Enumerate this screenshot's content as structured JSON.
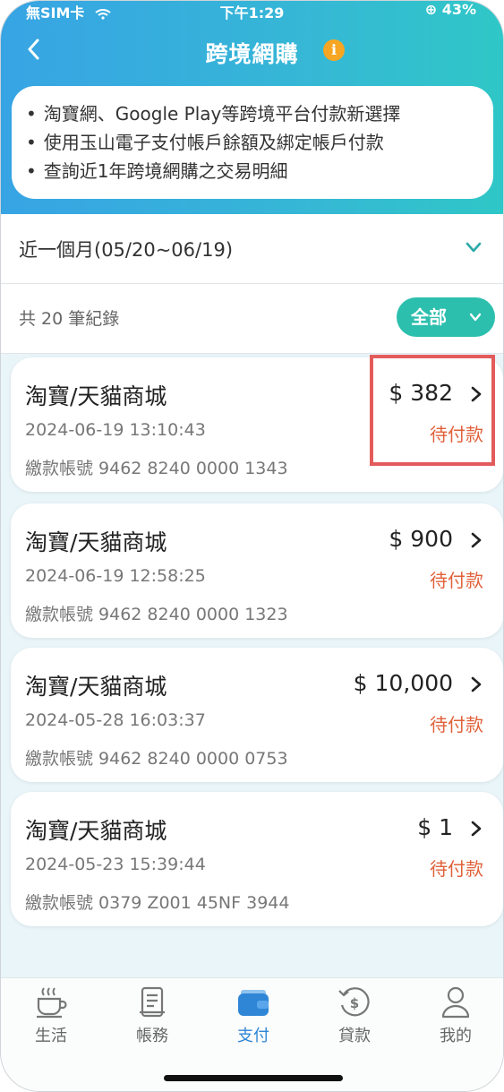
{
  "status_bar": {
    "carrier": "無SIM卡",
    "time": "下午1:29",
    "battery": "⊕ 43%"
  },
  "header": {
    "title": "跨境網購",
    "info_icon": "i"
  },
  "info": {
    "lines": [
      "淘寶網、Google Play等跨境平台付款新選擇",
      "使用玉山電子支付帳戶餘額及綁定帳戶付款",
      "查詢近1年跨境網購之交易明細"
    ]
  },
  "filter": {
    "period": "近一個月(05/20~06/19)",
    "record_count": "共 20 筆紀錄",
    "type_filter": "全部"
  },
  "transactions": [
    {
      "merchant": "淘寶/天貓商城",
      "datetime": "2024-06-19 13:10:43",
      "account": "繳款帳號 9462 8240 0000 1343",
      "amount": "$ 382",
      "status": "待付款"
    },
    {
      "merchant": "淘寶/天貓商城",
      "datetime": "2024-06-19 12:58:25",
      "account": "繳款帳號 9462 8240 0000 1323",
      "amount": "$ 900",
      "status": "待付款"
    },
    {
      "merchant": "淘寶/天貓商城",
      "datetime": "2024-05-28 16:03:37",
      "account": "繳款帳號 9462 8240 0000 0753",
      "amount": "$ 10,000",
      "status": "待付款"
    },
    {
      "merchant": "淘寶/天貓商城",
      "datetime": "2024-05-23 15:39:44",
      "account": "繳款帳號 0379 Z001 45NF 3944",
      "amount": "$ 1",
      "status": "待付款"
    }
  ],
  "tabbar": {
    "items": [
      {
        "label": "生活",
        "icon": "coffee-cup-icon"
      },
      {
        "label": "帳務",
        "icon": "document-icon"
      },
      {
        "label": "支付",
        "icon": "wallet-icon"
      },
      {
        "label": "貸款",
        "icon": "loan-dollar-icon"
      },
      {
        "label": "我的",
        "icon": "person-icon"
      }
    ],
    "active": "支付"
  },
  "colors": {
    "header_gradient_start": "#37a4e4",
    "header_gradient_end": "#2fc7c7",
    "accent_teal": "#2dbfae",
    "pending_status": "#e0613a",
    "highlight": "#e35b5b",
    "active_tab": "#2f86d6"
  }
}
